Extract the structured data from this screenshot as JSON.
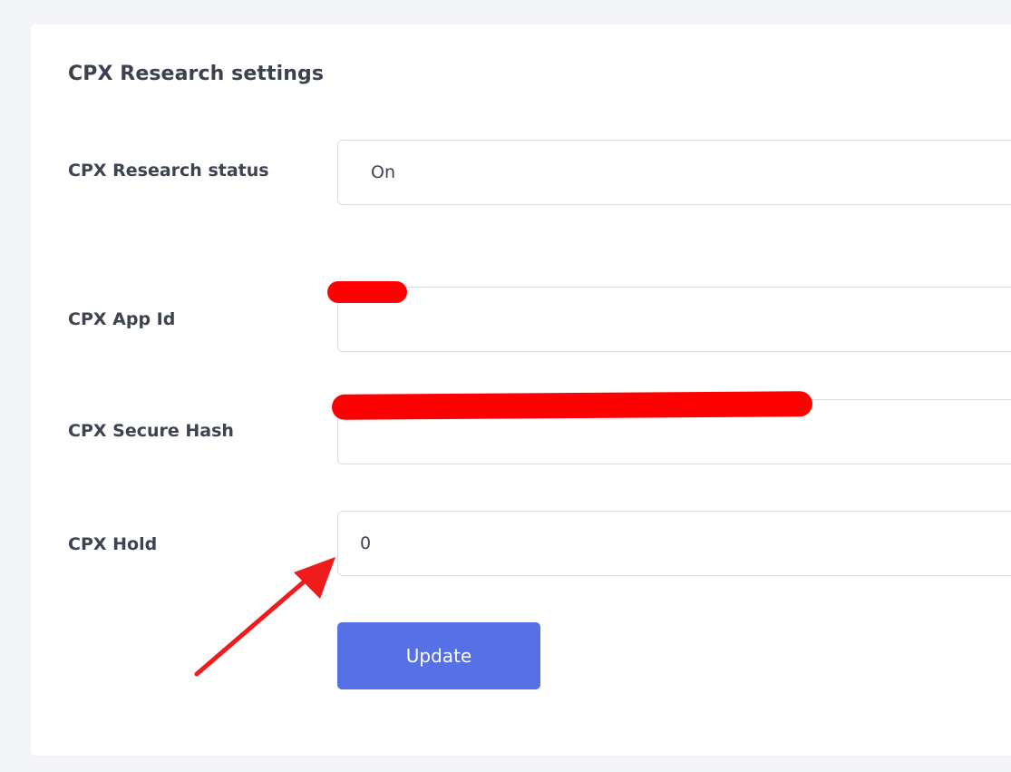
{
  "section": {
    "title": "CPX Research settings"
  },
  "fields": {
    "status": {
      "label": "CPX Research status",
      "value": "On"
    },
    "app_id": {
      "label": "CPX App Id",
      "value": ""
    },
    "secure_hash": {
      "label": "CPX Secure Hash",
      "value": ""
    },
    "hold": {
      "label": "CPX Hold",
      "value": "0"
    }
  },
  "actions": {
    "update_label": "Update"
  },
  "colors": {
    "primary_button": "#5670e5",
    "annotation_red": "#ff0000"
  }
}
